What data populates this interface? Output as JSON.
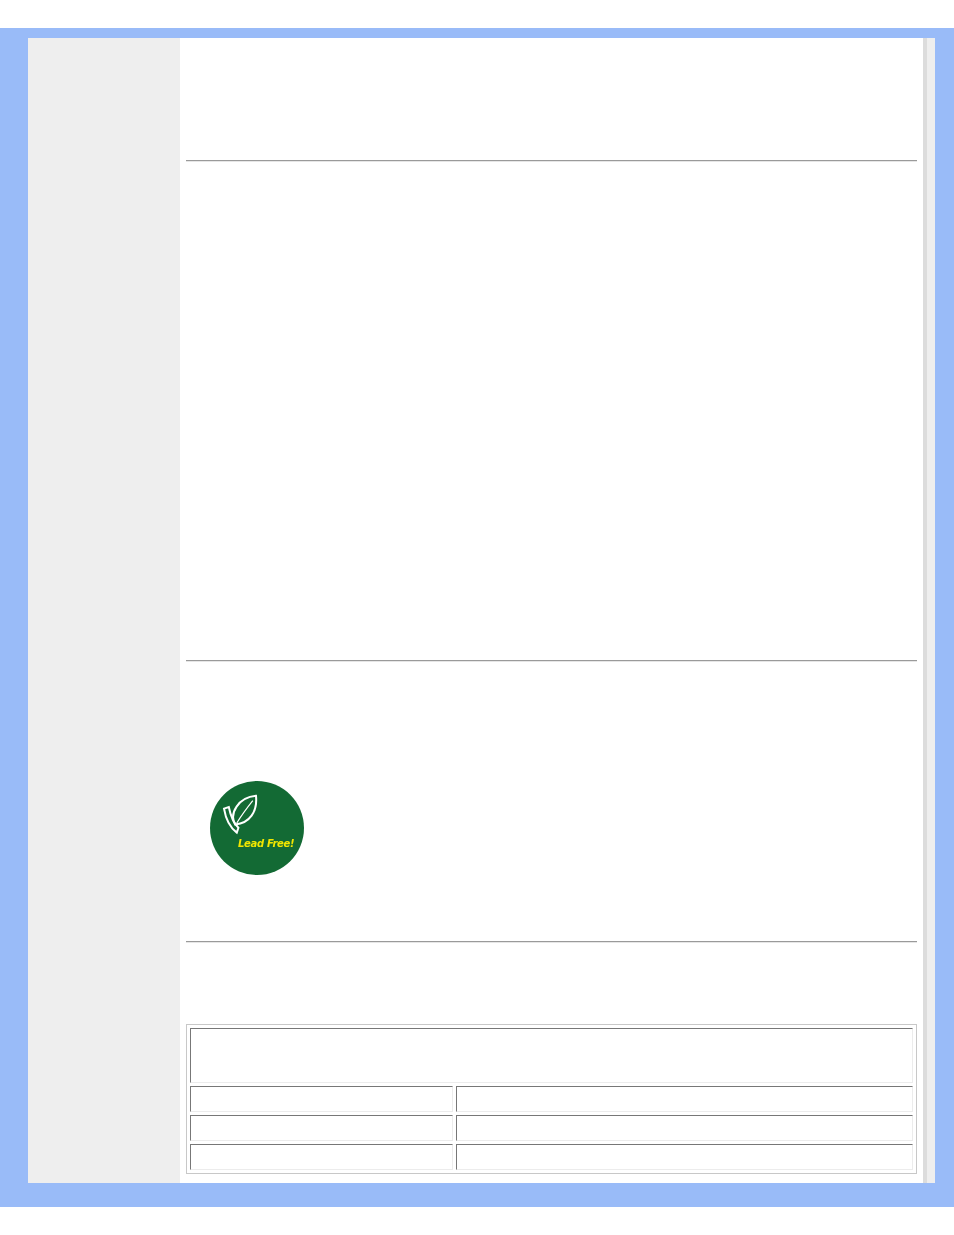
{
  "badge": {
    "label": "Lead Free!"
  }
}
